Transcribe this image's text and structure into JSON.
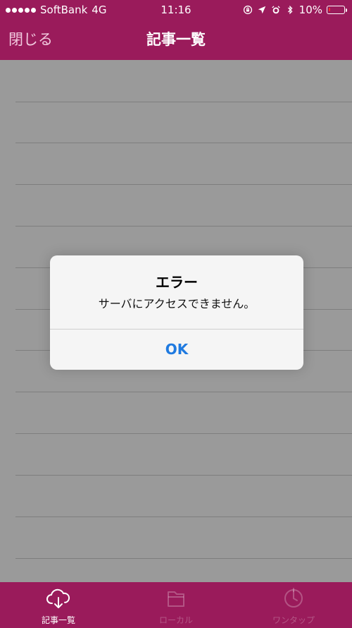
{
  "theme": {
    "brand": "#9a1b5b",
    "content_gray": "#9a9a9a",
    "ios_blue": "#1f7ae0",
    "battery_red": "#ff2a2a"
  },
  "status_bar": {
    "carrier": "SoftBank",
    "network": "4G",
    "time": "11:16",
    "battery_percent_text": "10%",
    "battery_level": 0.1
  },
  "nav": {
    "close_label": "閉じる",
    "title": "記事一覧"
  },
  "alert": {
    "title": "エラー",
    "message": "サーバにアクセスできません。",
    "ok_label": "OK"
  },
  "tabbar": {
    "items": [
      {
        "label": "記事一覧",
        "icon": "cloud-download-icon",
        "active": true
      },
      {
        "label": "ローカル",
        "icon": "folder-icon",
        "active": false
      },
      {
        "label": "ワンタップ",
        "icon": "timer-icon",
        "active": false
      }
    ]
  }
}
